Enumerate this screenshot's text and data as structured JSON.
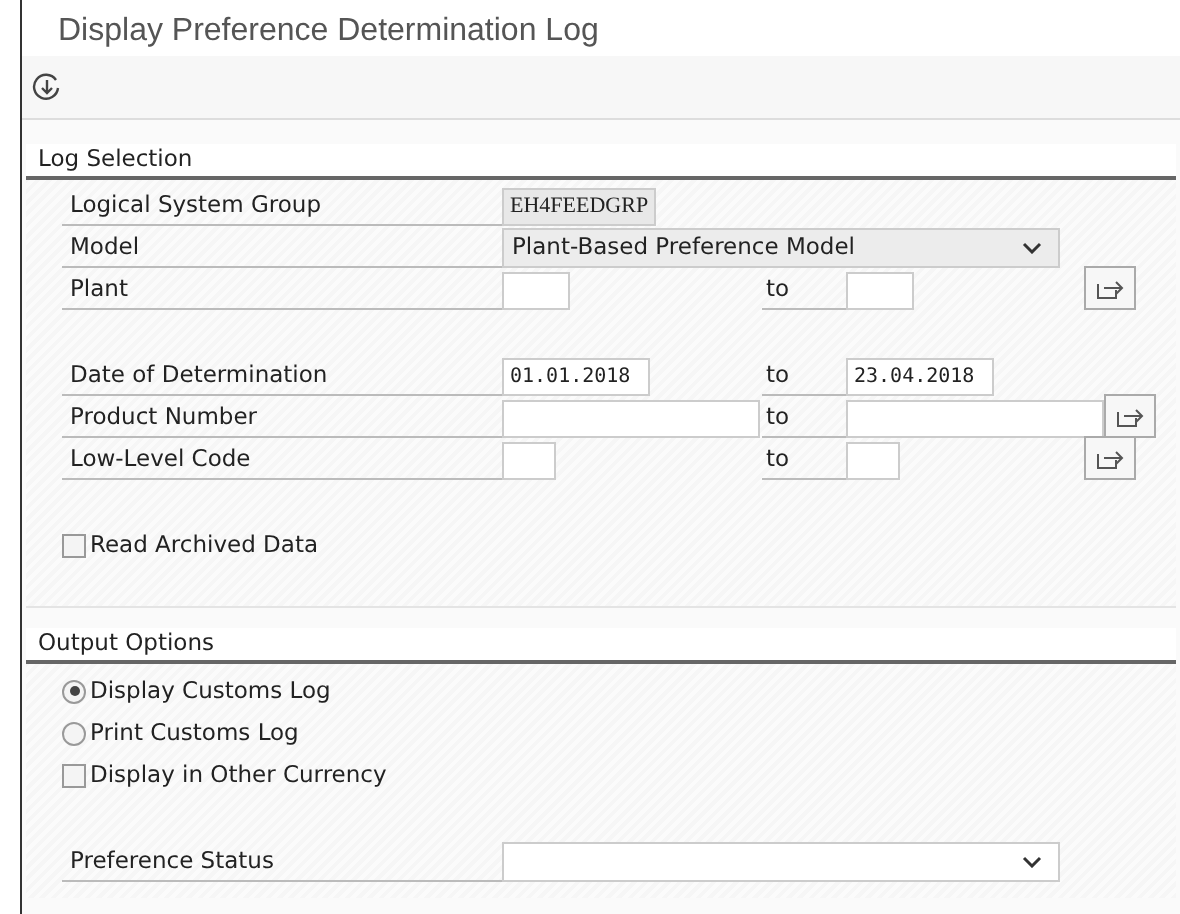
{
  "window": {
    "title": "Display Preference Determination Log"
  },
  "log_selection": {
    "title": "Log Selection",
    "rows": [
      {
        "kind": "display",
        "label": "Logical System Group",
        "value": "EH4FEEDGRP"
      },
      {
        "kind": "dropdown",
        "label": "Model",
        "value": "Plant-Based Preference Model"
      },
      {
        "kind": "range",
        "label": "Plant",
        "to_label": "to",
        "multiple": true
      },
      {
        "kind": "spacer"
      },
      {
        "kind": "range",
        "label": "Date of Determination",
        "from": "01.01.2018",
        "to_label": "to",
        "to": "23.04.2018",
        "multiple": false
      },
      {
        "kind": "range",
        "label": "Product Number",
        "to_label": "to",
        "multiple": true
      },
      {
        "kind": "range",
        "label": "Low-Level Code",
        "to_label": "to",
        "multiple": true
      }
    ],
    "checkbox": {
      "label": "Read Archived Data",
      "checked": false
    }
  },
  "output_options": {
    "title": "Output Options",
    "options": [
      {
        "kind": "radio",
        "label": "Display Customs Log",
        "selected": true
      },
      {
        "kind": "radio",
        "label": "Print Customs Log",
        "selected": false
      },
      {
        "kind": "checkbox",
        "label": "Display in Other Currency",
        "checked": false
      }
    ],
    "preference_status": {
      "label": "Preference Status"
    }
  }
}
